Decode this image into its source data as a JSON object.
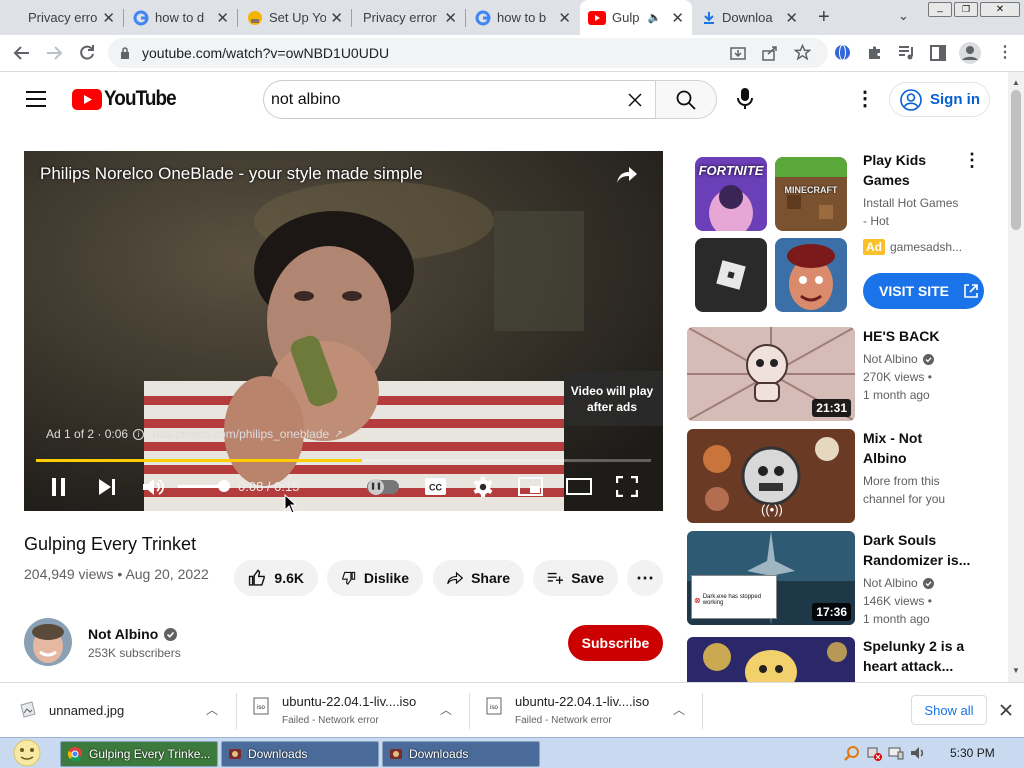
{
  "browser": {
    "tabs": [
      {
        "title": "Privacy error"
      },
      {
        "title": "how to d"
      },
      {
        "title": "Set Up Yo"
      },
      {
        "title": "Privacy error"
      },
      {
        "title": "how to b"
      },
      {
        "title": "Gulp"
      },
      {
        "title": "Downloa"
      }
    ],
    "url": "youtube.com/watch?v=owNBD1U0UDU"
  },
  "youtube": {
    "logo": "YouTube",
    "search_query": "not albino",
    "sign_in": "Sign in"
  },
  "player": {
    "ad_title": "Philips Norelco OneBlade - your style made simple",
    "ad_info": "Ad 1 of 2 · 0:06",
    "ad_link": "usa.philips.com/philips_oneblade",
    "skip_text_1": "Video will play",
    "skip_text_2": "after ads",
    "time": "0:08 / 0:15",
    "progress_fraction": 0.53,
    "volume_fraction": 1.0
  },
  "video": {
    "title": "Gulping Every Trinket",
    "views": "204,949 views",
    "date": "Aug 20, 2022",
    "likes": "9.6K",
    "dislike": "Dislike",
    "share": "Share",
    "save": "Save",
    "channel": "Not Albino",
    "subscribers": "253K subscribers",
    "subscribe": "Subscribe"
  },
  "ad_card": {
    "title_1": "Play Kids",
    "title_2": "Games",
    "desc_1": "Install Hot Games",
    "desc_2": "- Hot",
    "badge": "Ad",
    "advertiser": "gamesadsh...",
    "cta": "VISIT SITE",
    "tile_fortnite": "FORTNITE",
    "tile_minecraft": "MINECRAFT"
  },
  "recommendations": [
    {
      "title_1": "HE'S BACK",
      "title_2": "",
      "channel": "Not Albino",
      "views": "270K views •",
      "age": "1 month ago",
      "duration": "21:31"
    },
    {
      "title_1": "Mix - Not",
      "title_2": "Albino",
      "channel": "More from this",
      "views": "channel for you",
      "age": "",
      "duration": ""
    },
    {
      "title_1": "Dark Souls",
      "title_2": "Randomizer is...",
      "channel": "Not Albino",
      "views": "146K views •",
      "age": "1 month ago",
      "duration": "17:36"
    },
    {
      "title_1": "Spelunky 2 is a",
      "title_2": "heart attack...",
      "channel": "",
      "views": "",
      "age": "",
      "duration": ""
    }
  ],
  "dark_souls_popup": "Dark.exe has stopped working",
  "downloads": [
    {
      "name": "unnamed.jpg",
      "status": ""
    },
    {
      "name": "ubuntu-22.04.1-liv....iso",
      "status": "Failed - Network error"
    },
    {
      "name": "ubuntu-22.04.1-liv....iso",
      "status": "Failed - Network error"
    }
  ],
  "downloads_show_all": "Show all",
  "taskbar": {
    "items": [
      {
        "label": "Gulping Every Trinke..."
      },
      {
        "label": "Downloads"
      },
      {
        "label": "Downloads"
      }
    ],
    "clock": "5:30 PM"
  },
  "colors": {
    "yt_red": "#ff0000",
    "subscribe_red": "#cc0000",
    "link_blue": "#065fd4",
    "ad_progress": "#ffcc00",
    "visit_site_blue": "#1a73e8"
  }
}
